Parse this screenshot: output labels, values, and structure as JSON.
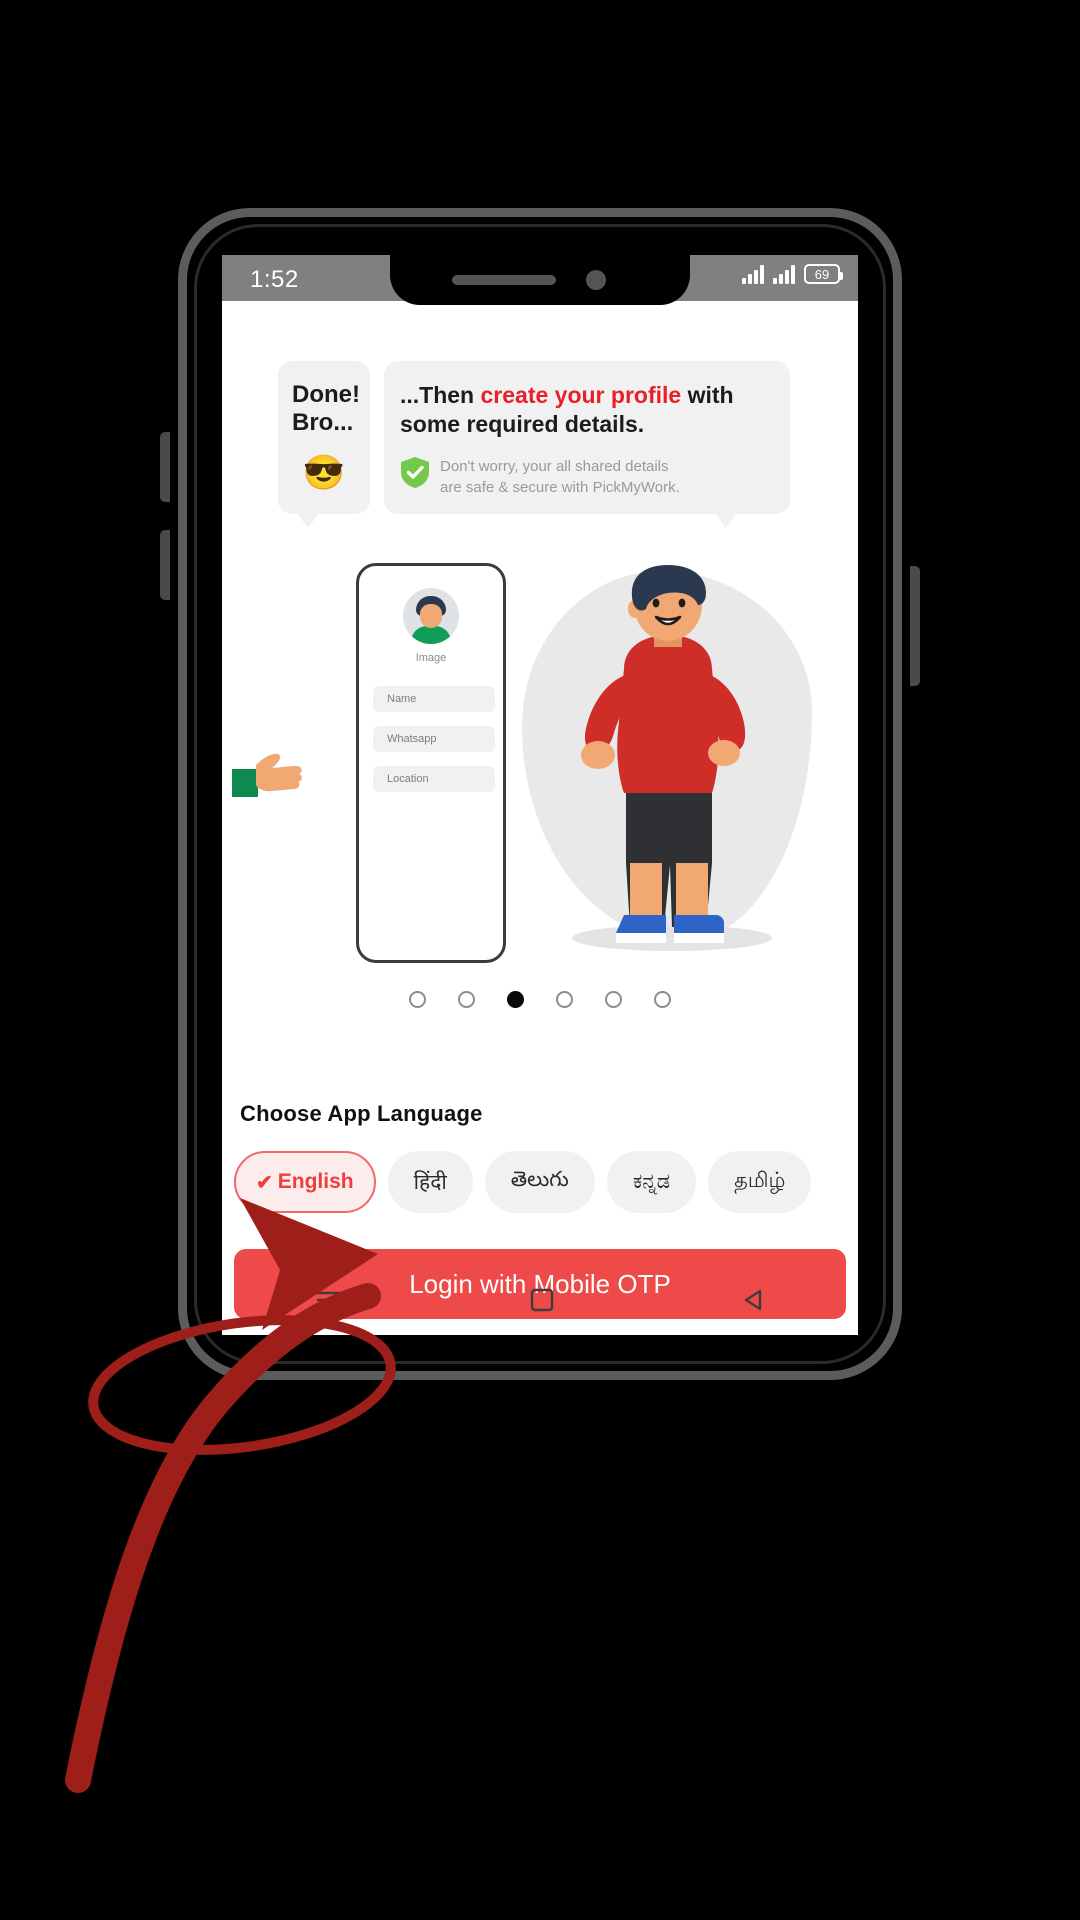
{
  "status_bar": {
    "time": "1:52",
    "battery_percent": "69",
    "signal_icon": "signal-bars-icon",
    "battery_icon": "battery-icon"
  },
  "onboarding": {
    "bubble_left": {
      "line1": "Done!",
      "line2": "Bro...",
      "emoji": "😎",
      "emoji_name": "sunglasses-face-emoji"
    },
    "bubble_right": {
      "headline_pre": "...Then ",
      "headline_highlight": "create your profile",
      "headline_post": " with some required details.",
      "note_line1": "Don't worry, your all shared details",
      "note_line2": "are safe & secure with PickMyWork.",
      "shield_icon": "green-shield-check-icon",
      "highlight_color": "#e8202a"
    },
    "illustration": {
      "caption": "Image",
      "fields": [
        "Name",
        "Whatsapp",
        "Location"
      ]
    },
    "carousel": {
      "total": 6,
      "active_index": 3
    }
  },
  "language_section": {
    "title": "Choose App Language",
    "options": [
      {
        "label": "English",
        "selected": true,
        "check_icon": "check-icon"
      },
      {
        "label": "हिंदी",
        "selected": false
      },
      {
        "label": "తెలుగు",
        "selected": false
      },
      {
        "label": "ಕನ್ನಡ",
        "selected": false
      },
      {
        "label": "தமிழ்",
        "selected": false
      }
    ]
  },
  "cta": {
    "login_label": "Login with Mobile OTP",
    "color": "#ee4a4a"
  },
  "nav_bar": {
    "items": [
      {
        "name": "menu-icon"
      },
      {
        "name": "home-square-icon"
      },
      {
        "name": "back-triangle-icon"
      }
    ]
  },
  "annotations": {
    "ellipse_name": "red-ellipse-highlight-english",
    "arrow_name": "red-arrow-pointing-login-button",
    "color": "#9e1f1a"
  }
}
